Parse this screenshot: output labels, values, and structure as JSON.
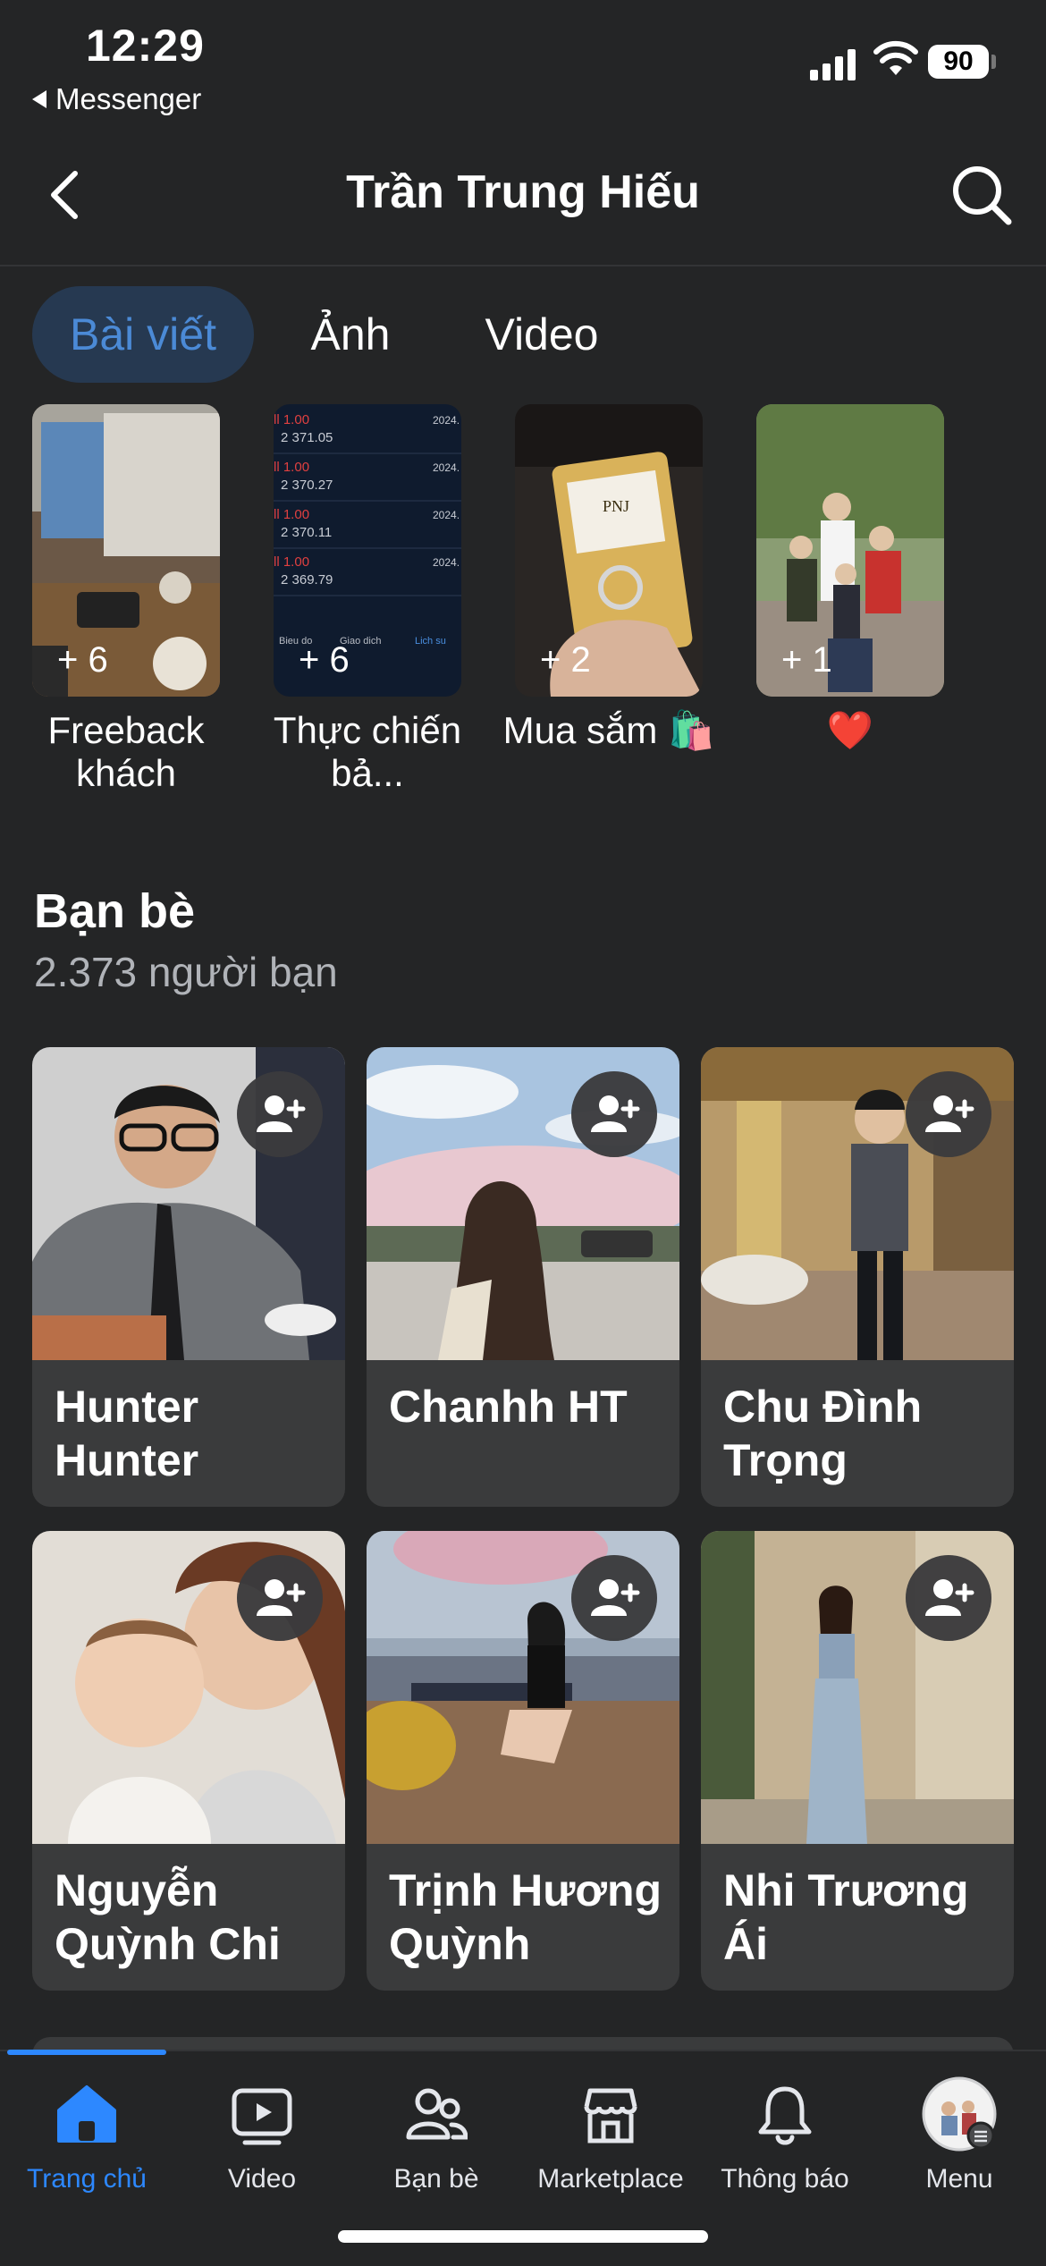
{
  "status_bar": {
    "time": "12:29",
    "back_app": "Messenger",
    "battery": "90"
  },
  "header": {
    "title": "Trần Trung Hiếu"
  },
  "tabs": [
    {
      "label": "Bài viết",
      "active": true
    },
    {
      "label": "Ảnh",
      "active": false
    },
    {
      "label": "Video",
      "active": false
    }
  ],
  "highlights": [
    {
      "label": "Freeback khách",
      "count": "+ 6"
    },
    {
      "label": "Thực chiến bả...",
      "count": "+ 6"
    },
    {
      "label": "Mua sắm 🛍️",
      "count": "+ 2"
    },
    {
      "label": "❤️",
      "count": "+ 1"
    }
  ],
  "highlight_screenshot_rows": [
    "2 371.05",
    "2 370.27",
    "2 370.11",
    "2 369.79"
  ],
  "highlight_screenshot_tag": "1.00",
  "highlight_screenshot_date": "2024.",
  "highlight_screenshot_tabs": [
    "Bieu do",
    "Giao dich",
    "Lich su"
  ],
  "box_brand": "PNJ",
  "friends": {
    "title": "Bạn bè",
    "count_text": "2.373 người bạn",
    "items": [
      {
        "name": "Hunter Hunter"
      },
      {
        "name": "Chanhh HT"
      },
      {
        "name": "Chu Đình Trọng"
      },
      {
        "name": "Nguyễn Quỳnh Chi"
      },
      {
        "name": "Trịnh Hương Quỳnh"
      },
      {
        "name": "Nhi Trương Ái"
      }
    ]
  },
  "bottom_nav": [
    {
      "label": "Trang chủ",
      "icon": "home-icon",
      "active": true
    },
    {
      "label": "Video",
      "icon": "video-icon",
      "active": false
    },
    {
      "label": "Bạn bè",
      "icon": "friends-icon",
      "active": false
    },
    {
      "label": "Marketplace",
      "icon": "marketplace-icon",
      "active": false
    },
    {
      "label": "Thông báo",
      "icon": "bell-icon",
      "active": false
    },
    {
      "label": "Menu",
      "icon": "profile-avatar-icon",
      "active": false
    }
  ],
  "colors": {
    "background": "#242526",
    "accent": "#2d88ff",
    "active_tab_bg": "#263951",
    "card": "#3a3b3c"
  }
}
